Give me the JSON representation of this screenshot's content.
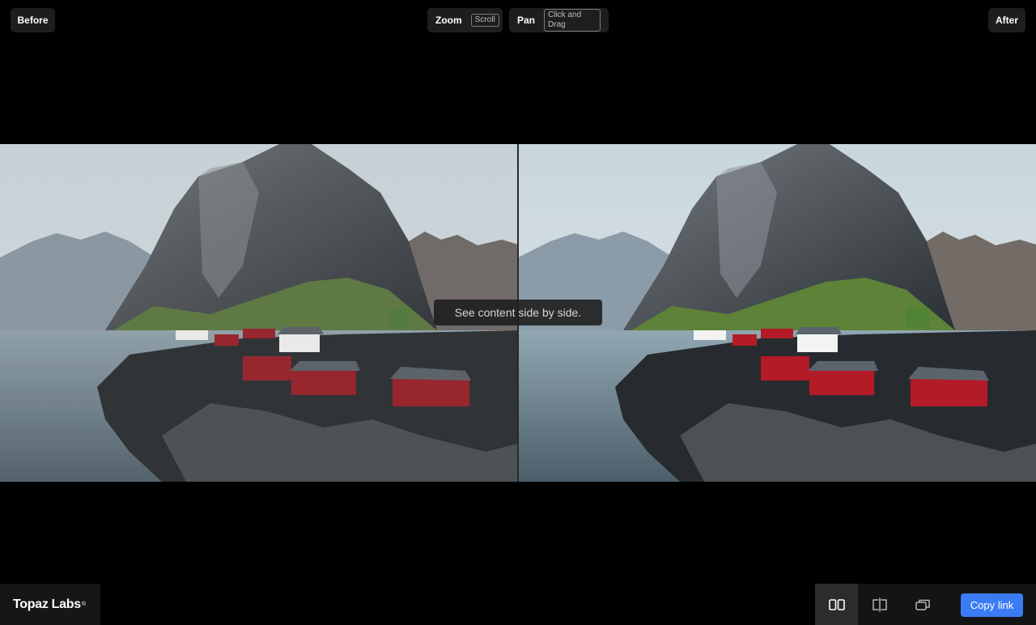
{
  "header": {
    "before_label": "Before",
    "after_label": "After",
    "zoom": {
      "label": "Zoom",
      "hint": "Scroll"
    },
    "pan": {
      "label": "Pan",
      "hint": "Click and Drag"
    }
  },
  "viewer": {
    "tooltip": "See content side by side."
  },
  "footer": {
    "logo_text": "Topaz Labs",
    "logo_mark": "®",
    "view_modes": [
      {
        "icon": "side-by-side-icon",
        "active": true
      },
      {
        "icon": "split-view-icon",
        "active": false
      },
      {
        "icon": "overlay-view-icon",
        "active": false
      }
    ],
    "copy_link_label": "Copy link"
  },
  "colors": {
    "background": "#000000",
    "pill_bg": "#1e1e1e",
    "accent": "#3b7cf5",
    "toolbar_bg": "#141414",
    "active_mode_bg": "#2c2c2c"
  }
}
